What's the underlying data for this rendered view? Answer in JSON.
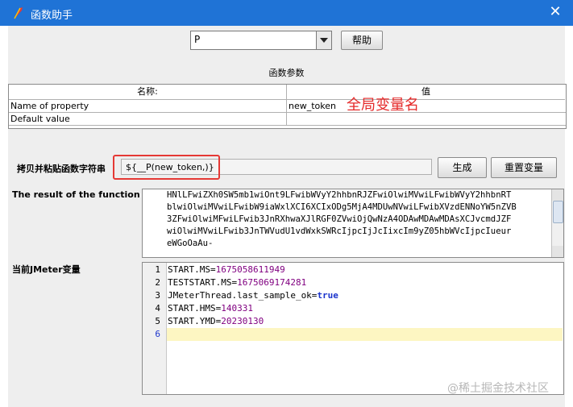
{
  "window": {
    "title": "函数助手",
    "close_glyph": "✕"
  },
  "function_select": {
    "selected": "P"
  },
  "buttons": {
    "help": "帮助",
    "generate": "生成",
    "reset_vars": "重置变量"
  },
  "params": {
    "section_title": "函数参数",
    "columns": [
      "名称:",
      "值"
    ],
    "rows": [
      {
        "name": "Name of property",
        "value": "new_token"
      },
      {
        "name": "Default value",
        "value": ""
      }
    ],
    "annotation": "全局变量名"
  },
  "copy_string": {
    "label": "拷贝并粘贴函数字符串",
    "value": "${__P(new_token,)}"
  },
  "result": {
    "label": "The result of the function is",
    "lines": [
      "HNlLFwiZXh0SW5mb1wiOnt9LFwibWVyY2hhbnRJZFwiOlwiMVwiLFwibWVyY2hhbnRT",
      "blwiOlwiMVwiLFwibW9iaWxlXCI6XCIxODg5MjA4MDUwNVwiLFwibXVzdENNoYW5nZVB",
      "3ZFwiOlwiMFwiLFwib3JnRXhwaXJlRGF0ZVwiOjQwNzA4ODAwMDAwMDAsXCJvcmdJZF",
      "wiOlwiMVwiLFwib3JnTWVudU1vdWxkSWRcIjpcIjJcIixcIm9yZ05hbWVcIjpcIueur",
      "eWGoOaAu-"
    ]
  },
  "jmeter_vars": {
    "label": "当前JMeter变量",
    "lines": [
      {
        "num": "1",
        "key": "START.MS=",
        "value": "1675058611949"
      },
      {
        "num": "2",
        "key": "TESTSTART.MS=",
        "value": "1675069174281"
      },
      {
        "num": "3",
        "key": "JMeterThread.last_sample_ok=",
        "value": "true"
      },
      {
        "num": "4",
        "key": "START.HMS=",
        "value": "140331"
      },
      {
        "num": "5",
        "key": "START.YMD=",
        "value": "20230130"
      },
      {
        "num": "6",
        "key": "",
        "value": ""
      }
    ]
  },
  "watermark": "@稀土掘金技术社区",
  "icons": {
    "app": "feather-icon",
    "dropdown": "chevron-down-icon",
    "close": "close-icon"
  },
  "colors": {
    "titlebar": "#1f73d6",
    "annotation": "#e52a2a",
    "highlight_box": "#e53935",
    "var_value": "#800080",
    "keyword": "#1a33cc"
  }
}
